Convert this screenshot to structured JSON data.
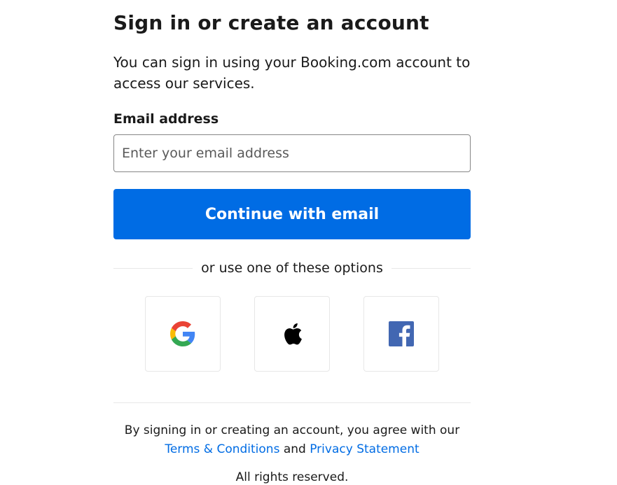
{
  "header": {
    "title": "Sign in or create an account",
    "subtitle": "You can sign in using your Booking.com account to access our services."
  },
  "form": {
    "email_label": "Email address",
    "email_placeholder": "Enter your email address",
    "email_value": "",
    "continue_label": "Continue with email"
  },
  "alternatives": {
    "divider_text": "or use one of these options",
    "options": [
      {
        "provider": "Google",
        "icon": "google-icon"
      },
      {
        "provider": "Apple",
        "icon": "apple-icon"
      },
      {
        "provider": "Facebook",
        "icon": "facebook-icon"
      }
    ]
  },
  "footer": {
    "agreement_prefix": "By signing in or creating an account, you agree with our",
    "terms_link": "Terms & Conditions",
    "and_text": "and",
    "privacy_link": "Privacy Statement",
    "rights_text": "All rights reserved."
  },
  "colors": {
    "primary": "#006ce4",
    "link": "#006ce4",
    "text": "#1a1a1a",
    "border": "#e7e7e7",
    "facebook": "#4267b2"
  }
}
